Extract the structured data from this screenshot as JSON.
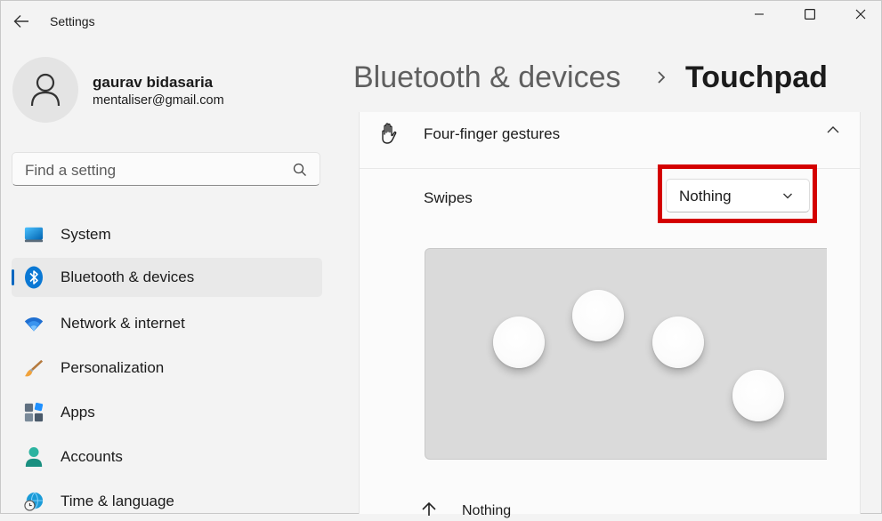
{
  "window": {
    "title": "Settings"
  },
  "user": {
    "name": "gaurav bidasaria",
    "email": "mentaliser@gmail.com"
  },
  "search": {
    "placeholder": "Find a setting"
  },
  "nav": {
    "items": [
      {
        "label": "System",
        "icon": "system-icon",
        "active": false
      },
      {
        "label": "Bluetooth & devices",
        "icon": "bluetooth-icon",
        "active": true
      },
      {
        "label": "Network & internet",
        "icon": "wifi-icon",
        "active": false
      },
      {
        "label": "Personalization",
        "icon": "paintbrush-icon",
        "active": false
      },
      {
        "label": "Apps",
        "icon": "apps-icon",
        "active": false
      },
      {
        "label": "Accounts",
        "icon": "accounts-icon",
        "active": false
      },
      {
        "label": "Time & language",
        "icon": "clock-globe-icon",
        "active": false
      }
    ]
  },
  "header": {
    "parent": "Bluetooth & devices",
    "separator": "›",
    "current": "Touchpad"
  },
  "gestures": {
    "section_title": "Four-finger gestures",
    "section_expanded": true,
    "swipes_label": "Swipes",
    "swipes_value": "Nothing",
    "bottom_item": "Nothing"
  },
  "colors": {
    "accent": "#0067c0",
    "highlight": "#d40000"
  }
}
